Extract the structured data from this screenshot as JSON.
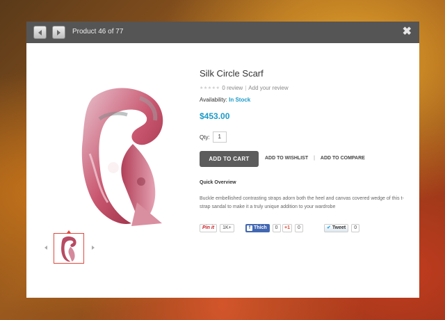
{
  "header": {
    "counter_text": "Product 46 of 77"
  },
  "product": {
    "title": "Silk Circle Scarf",
    "review_text": "0 review",
    "add_review_text": "Add your review",
    "availability_label": "Availability:",
    "availability_value": "In Stock",
    "price": "$453.00",
    "qty_label": "Qty:",
    "qty_value": "1",
    "add_to_cart_label": "ADD TO CART",
    "add_to_wishlist_label": "ADD TO WISHLIST",
    "add_to_compare_label": "ADD TO COMPARE",
    "overview_title": "Quick Overview",
    "overview_text": "Buckle embellished contrasting straps adorn both the heel and canvas covered wedge of this t-strap sandal to make it a truly unique addition to your wardrobe"
  },
  "social": {
    "pinterest_label": "Pin it",
    "pinterest_count": "1K+",
    "facebook_label": "Thích",
    "facebook_count": "0",
    "gplus_label": "+1",
    "gplus_count": "0",
    "twitter_label": "Tweet",
    "twitter_count": "0"
  },
  "colors": {
    "accent": "#1a9ac8",
    "thumb_border": "#e2483d"
  }
}
